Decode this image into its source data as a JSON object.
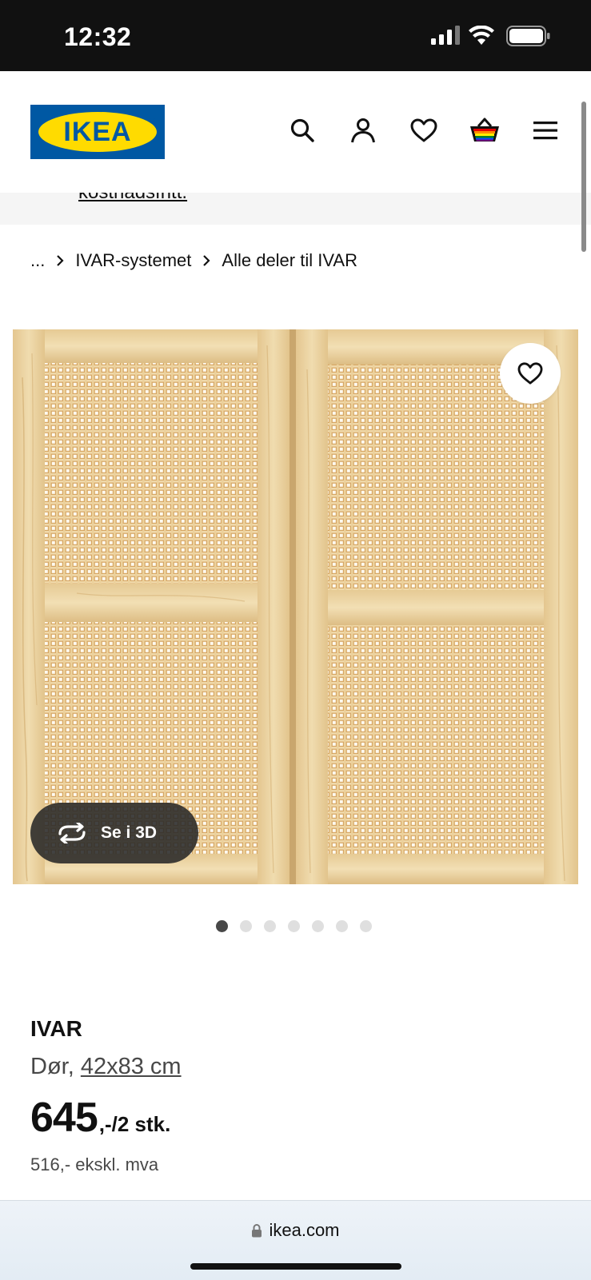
{
  "status_bar": {
    "time": "12:32"
  },
  "header": {
    "logo_text": "IKEA",
    "logo_reg": "®",
    "icons": [
      "search-icon",
      "account-icon",
      "heart-icon",
      "basket-icon",
      "menu-icon"
    ]
  },
  "promo": {
    "link_text": "kostnadsfritt."
  },
  "breadcrumb": {
    "items": [
      "...",
      "IVAR-systemet",
      "Alle deler til IVAR"
    ]
  },
  "gallery": {
    "view3d_label": "Se i 3D",
    "dot_count": 7,
    "active_dot": 1
  },
  "product": {
    "name": "IVAR",
    "type": "Dør,",
    "dimensions": "42x83 cm",
    "price_integer": "645",
    "price_suffix": ",-/2 stk.",
    "price_ex_vat": "516,- ekskl. mva"
  },
  "browser": {
    "url": "ikea.com"
  },
  "colors": {
    "ikea_blue": "#0058a3",
    "ikea_yellow": "#ffdb00",
    "pine": "#e9cf98"
  }
}
